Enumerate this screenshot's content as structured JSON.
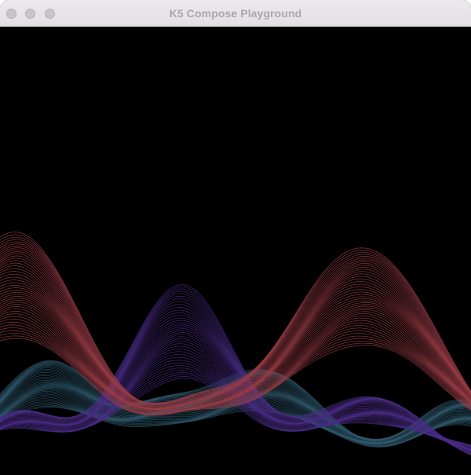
{
  "window": {
    "title": "K5 Compose Playground",
    "buttons": [
      {
        "name": "close",
        "color": "#c9c6c9"
      },
      {
        "name": "minimize",
        "color": "#c9c6c9"
      },
      {
        "name": "zoom",
        "color": "#c9c6c9"
      }
    ]
  },
  "canvas": {
    "background": "#000000",
    "content": "animated wave lines",
    "palette": {
      "red": "#9a3c46",
      "purple": "#4a2c86",
      "teal": "#2f5a6e"
    }
  }
}
